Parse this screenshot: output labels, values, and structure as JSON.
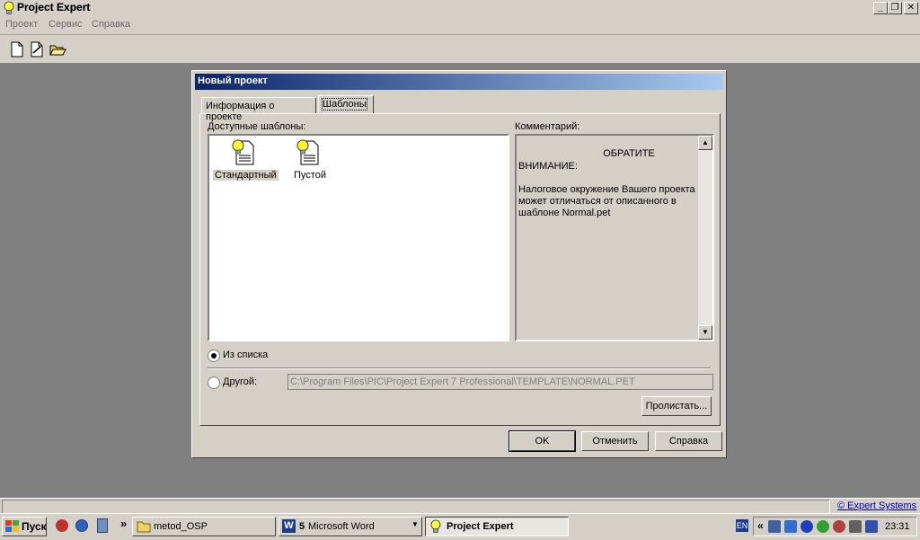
{
  "window": {
    "title": "Project Expert",
    "caption_minimize": "_",
    "caption_restore": "❐",
    "caption_close": "✕"
  },
  "menu": [
    "Проект",
    "Сервис",
    "Справка"
  ],
  "dialog": {
    "title": "Новый проект",
    "tabs": [
      "Информация о проекте",
      "Шаблоны"
    ],
    "templates_label": "Доступные шаблоны:",
    "templates": [
      {
        "name": "Стандартный",
        "selected": true
      },
      {
        "name": "Пустой",
        "selected": false
      }
    ],
    "comment_label": "Комментарий:",
    "comment_line1": "ОБРАТИТЕ",
    "comment_line2": "ВНИМАНИЕ:",
    "comment_body": "Налоговое окружение Вашего проекта может отличаться от описанного в шаблоне Normal.pet",
    "radio_list_label": "Из списка",
    "radio_other_label": "Другой:",
    "path_value": "C:\\Program Files\\PIC\\Project Expert 7 Professional\\TEMPLATE\\NORMAL.PET",
    "browse_button": "Пролистать...",
    "ok_button": "OK",
    "cancel_button": "Отменить",
    "help_button": "Справка"
  },
  "statusbar": {
    "link": "© Expert Systems"
  },
  "taskbar": {
    "start": "Пуск",
    "more": "»",
    "tasks": [
      {
        "label": "metod_OSP"
      },
      {
        "count": "5",
        "label": "Microsoft Word"
      },
      {
        "label": "Project Expert"
      }
    ],
    "lang": "EN",
    "tray_expand": "«",
    "clock": "23:31"
  }
}
